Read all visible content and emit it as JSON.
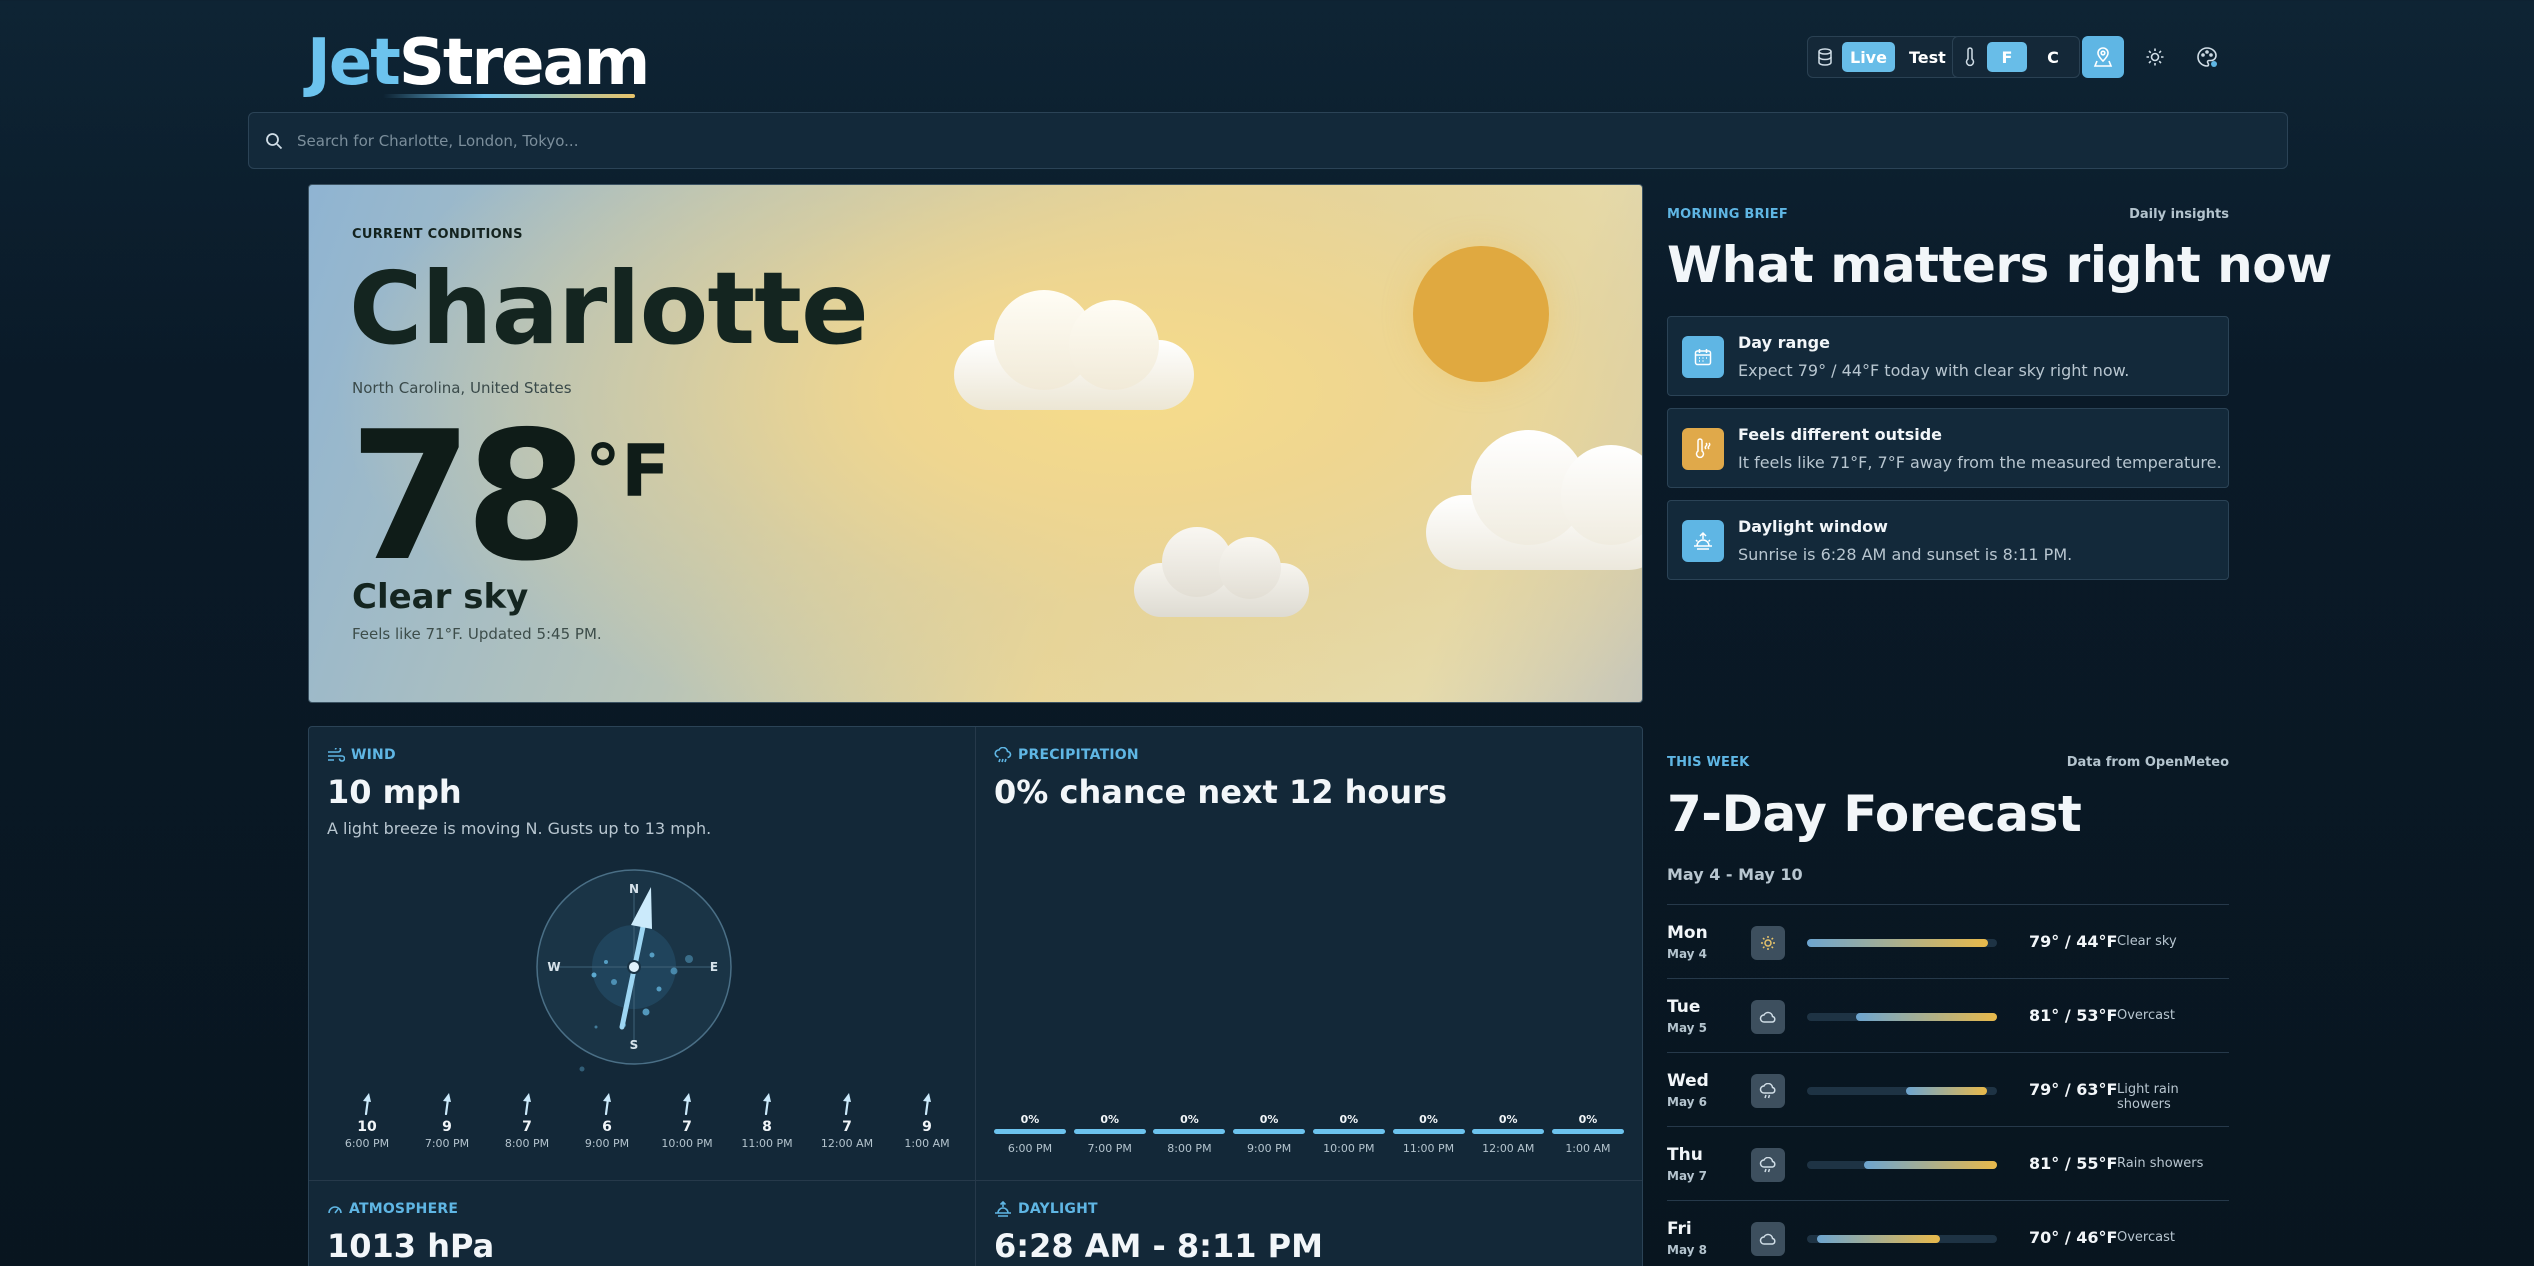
{
  "app": {
    "logo_part1": "Jet",
    "logo_part2": "Stream"
  },
  "header": {
    "source_live": "Live",
    "source_test": "Test",
    "unit_f": "F",
    "unit_c": "C"
  },
  "search": {
    "placeholder": "Search for Charlotte, London, Tokyo..."
  },
  "current": {
    "eyebrow": "CURRENT CONDITIONS",
    "city": "Charlotte",
    "region": "North Carolina, United States",
    "temp": "78",
    "unit": "°F",
    "condition": "Clear sky",
    "feels": "Feels like 71°F. Updated 5:45 PM."
  },
  "brief": {
    "eyebrow": "MORNING BRIEF",
    "side": "Daily insights",
    "title": "What matters right now",
    "cards": [
      {
        "title": "Day range",
        "desc": "Expect 79° / 44°F today with clear sky right now.",
        "icon": "calendar-icon",
        "color": "#5fb6e4"
      },
      {
        "title": "Feels different outside",
        "desc": "It feels like 71°F, 7°F away from the measured temperature.",
        "icon": "thermometer-icon",
        "color": "#e0a94a"
      },
      {
        "title": "Daylight window",
        "desc": "Sunrise is 6:28 AM and sunset is 8:11 PM.",
        "icon": "sunrise-icon",
        "color": "#5fb6e4"
      }
    ]
  },
  "wind": {
    "label": "WIND",
    "value": "10 mph",
    "desc": "A light breeze is moving N. Gusts up to 13 mph.",
    "compass": {
      "n": "N",
      "e": "E",
      "s": "S",
      "w": "W"
    },
    "hours": [
      {
        "v": "10",
        "t": "6:00 PM"
      },
      {
        "v": "9",
        "t": "7:00 PM"
      },
      {
        "v": "7",
        "t": "8:00 PM"
      },
      {
        "v": "6",
        "t": "9:00 PM"
      },
      {
        "v": "7",
        "t": "10:00 PM"
      },
      {
        "v": "8",
        "t": "11:00 PM"
      },
      {
        "v": "7",
        "t": "12:00 AM"
      },
      {
        "v": "9",
        "t": "1:00 AM"
      }
    ]
  },
  "precip": {
    "label": "PRECIPITATION",
    "value": "0% chance next 12 hours",
    "hours": [
      {
        "v": "0%",
        "t": "6:00 PM"
      },
      {
        "v": "0%",
        "t": "7:00 PM"
      },
      {
        "v": "0%",
        "t": "8:00 PM"
      },
      {
        "v": "0%",
        "t": "9:00 PM"
      },
      {
        "v": "0%",
        "t": "10:00 PM"
      },
      {
        "v": "0%",
        "t": "11:00 PM"
      },
      {
        "v": "0%",
        "t": "12:00 AM"
      },
      {
        "v": "0%",
        "t": "1:00 AM"
      }
    ]
  },
  "atmosphere": {
    "label": "ATMOSPHERE",
    "value": "1013 hPa"
  },
  "daylight": {
    "label": "DAYLIGHT",
    "value": "6:28 AM - 8:11 PM"
  },
  "week": {
    "eyebrow": "THIS WEEK",
    "side": "Data from OpenMeteo",
    "title": "7-Day Forecast",
    "range": "May 4 - May 10",
    "days": [
      {
        "day": "Mon",
        "date": "May 4",
        "hilo": "79° / 44°F",
        "cond": "Clear sky",
        "icon": "sun-icon",
        "start": 0.0,
        "end": 0.95
      },
      {
        "day": "Tue",
        "date": "May 5",
        "hilo": "81° / 53°F",
        "cond": "Overcast",
        "icon": "cloud-icon",
        "start": 0.26,
        "end": 1.0
      },
      {
        "day": "Wed",
        "date": "May 6",
        "hilo": "79° / 63°F",
        "cond": "Light rain showers",
        "icon": "rain-cloud-icon",
        "start": 0.52,
        "end": 0.95
      },
      {
        "day": "Thu",
        "date": "May 7",
        "hilo": "81° / 55°F",
        "cond": "Rain showers",
        "icon": "rain-cloud-icon",
        "start": 0.3,
        "end": 1.0
      },
      {
        "day": "Fri",
        "date": "May 8",
        "hilo": "70° / 46°F",
        "cond": "Overcast",
        "icon": "cloud-icon",
        "start": 0.05,
        "end": 0.7
      }
    ]
  }
}
